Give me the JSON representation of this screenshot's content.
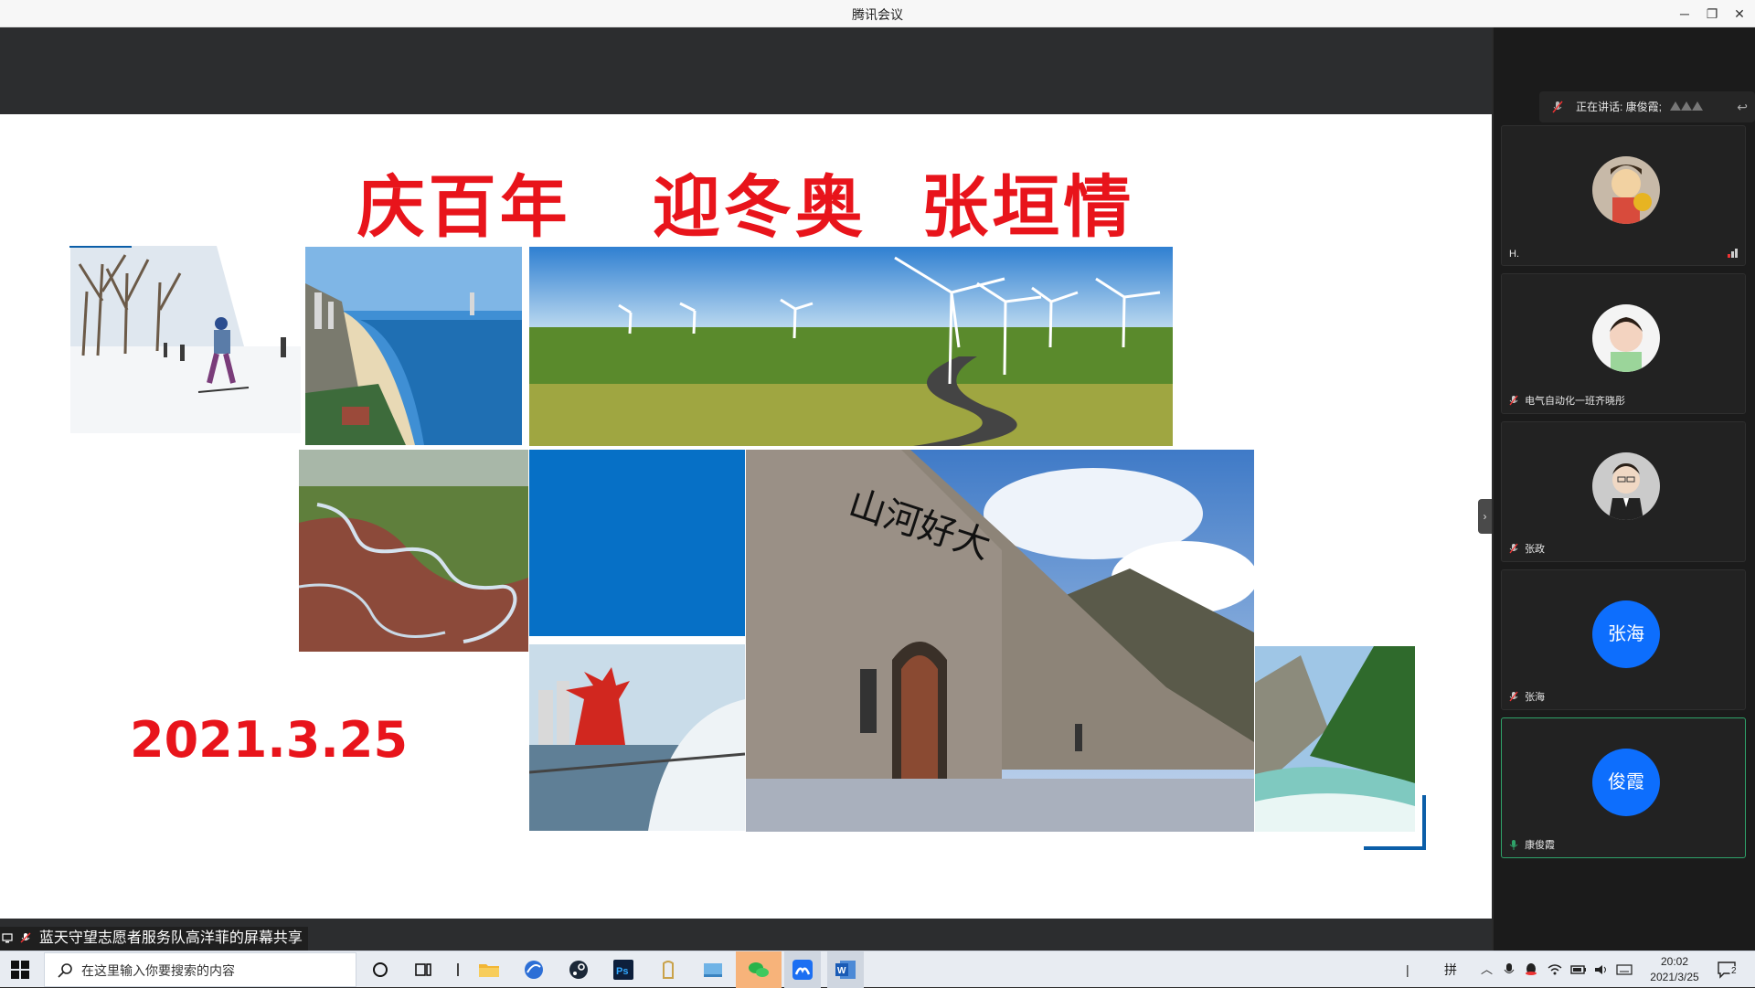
{
  "window": {
    "title": "腾讯会议",
    "minimize": "─",
    "restore": "❐",
    "close": "✕"
  },
  "slide": {
    "title": "庆百年   迎冬奥  张垣情",
    "date": "2021.3.25"
  },
  "share": {
    "label": "蓝天守望志愿者服务队高洋菲的屏幕共享",
    "toggle": "›"
  },
  "panel": {
    "speaking_label": "正在讲话: 康俊霞;",
    "reply_icon": "↩",
    "participants": [
      {
        "name": "H.",
        "avatar": "cartoon-avatar",
        "muted": false
      },
      {
        "name": "电气自动化一班齐晓彤",
        "avatar": "child-avatar",
        "muted": true
      },
      {
        "name": "张政",
        "avatar": "man-avatar",
        "muted": true
      },
      {
        "name": "张海",
        "avatar_text": "张海",
        "muted": true
      },
      {
        "name": "康俊霞",
        "avatar_text": "俊霞",
        "muted": false,
        "active": true
      }
    ]
  },
  "taskbar": {
    "search_placeholder": "在这里输入你要搜索的内容",
    "ime_label": "拼",
    "time": "20:02",
    "date": "2021/3/25",
    "notification_count": "2"
  },
  "colors": {
    "slide_red": "#e8141b",
    "blue": "#0670c6",
    "meeting_blue": "#0d6efd",
    "active_tile": "#2fa36a"
  }
}
